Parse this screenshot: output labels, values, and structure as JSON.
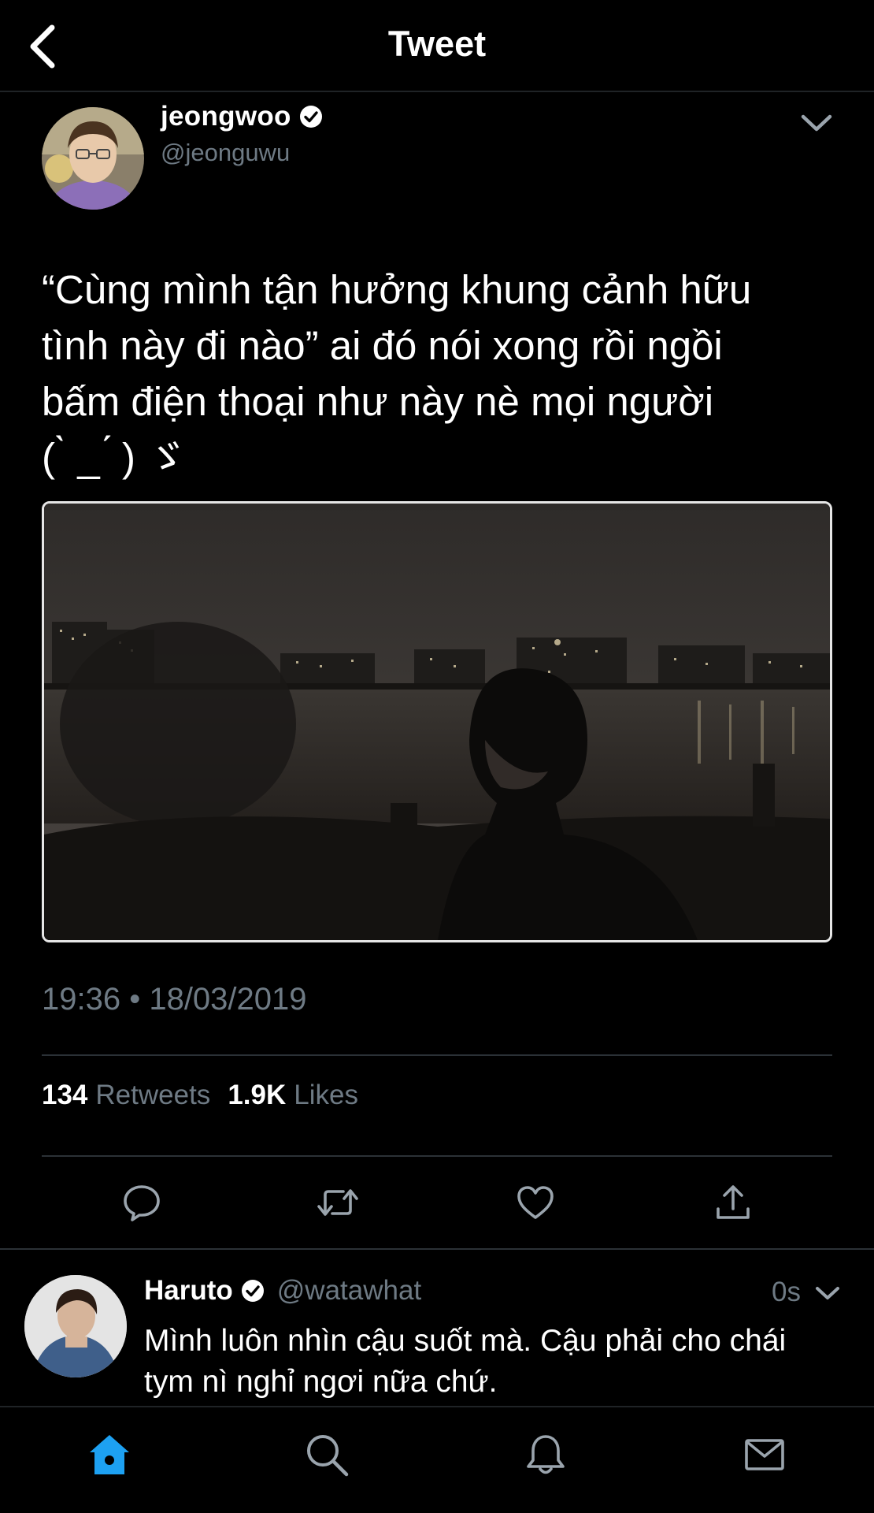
{
  "header": {
    "title": "Tweet"
  },
  "tweet": {
    "author_name": "jeongwoo",
    "author_handle": "@jeonguwu",
    "text": "“Cùng mình tận hưởng khung cảnh hữu\ntình này đi nào” ai đó nói xong rồi ngồi\nbấm điện thoại như này nè mọi người\n( ̀ _ ́ ) ゞ",
    "timestamp": "19:36 • 18/03/2019",
    "retweets_count": "134",
    "retweets_label": "Retweets",
    "likes_count": "1.9K",
    "likes_label": "Likes"
  },
  "reply": {
    "author_name": "Haruto",
    "author_handle": "@watawhat",
    "time": "0s",
    "text": "Mình luôn nhìn cậu suốt mà. Cậu phải cho chái tym nì nghỉ ngơi nữa chứ."
  },
  "colors": {
    "background": "#000000",
    "secondary_text": "#6e7a84",
    "accent": "#1da1f2",
    "divider": "#2b3136"
  },
  "tabs": [
    {
      "icon": "home-icon",
      "active": true
    },
    {
      "icon": "search-icon",
      "active": false
    },
    {
      "icon": "bell-icon",
      "active": false
    },
    {
      "icon": "mail-icon",
      "active": false
    }
  ]
}
